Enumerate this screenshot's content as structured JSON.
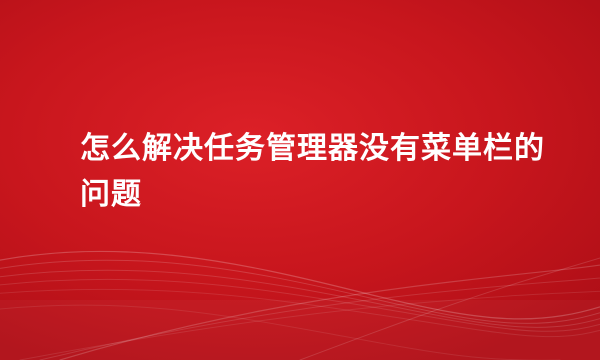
{
  "title": "怎么解决任务管理器没有菜单栏的问题",
  "colors": {
    "background": "#c8161d",
    "text": "#ffffff"
  }
}
